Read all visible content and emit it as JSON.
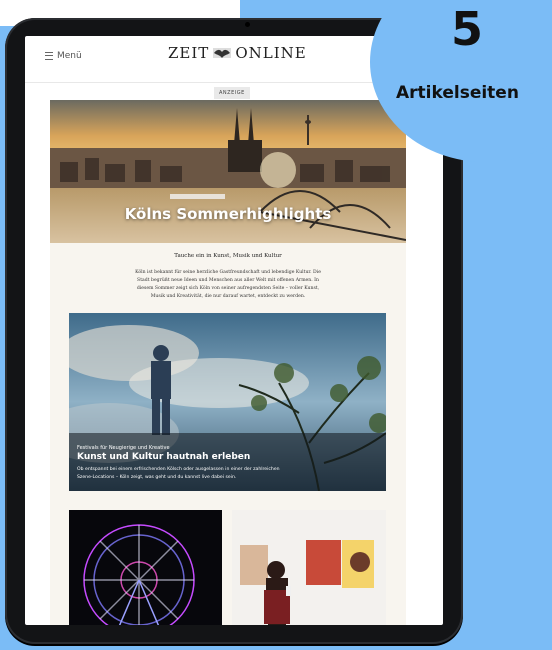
{
  "header": {
    "menu_label": "Menü",
    "logo_left": "ZEIT",
    "logo_right": "ONLINE"
  },
  "ad_label": "ANZEIGE",
  "hero": {
    "title": "Kölns Sommerhighlights"
  },
  "intro": {
    "headline": "Tauche ein in Kunst, Musik und Kultur",
    "line1": "Köln ist bekannt für seine herzliche Gastfreundschaft und lebendige Kultur. Die",
    "line2": "Stadt begrüßt neue Ideen und Menschen aus aller Welt mit offenen Armen. In",
    "line3": "diesem Sommer zeigt sich Köln von seiner aufregendsten Seite – voller Kunst,",
    "line4": "Musik und Kreativität, die nur darauf wartet, entdeckt zu werden."
  },
  "feature": {
    "kicker": "Festivals für Neugierige und Kreative",
    "title": "Kunst und Kultur hautnah erleben",
    "desc_line1": "Ob entspannt bei einem erfrischenden Kölsch oder ausgelassen in einer der zahlreichen",
    "desc_line2": "Szene-Locations – Köln zeigt, was geht und du kannst live dabei sein."
  },
  "badge": {
    "number": "5",
    "label": "Artikelseiten"
  },
  "colors": {
    "background": "#7bbcf6",
    "device": "#131416",
    "content_bg": "#f8f5ef"
  }
}
